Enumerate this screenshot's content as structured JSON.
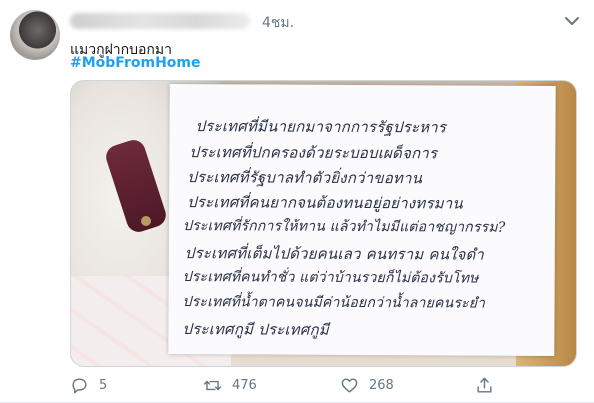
{
  "tweet": {
    "time": "4ชม.",
    "text": "แมวกูฝากบอกมา",
    "hashtag": "#MobFromHome",
    "image_text_lines": [
      "ประเทศที่มีนายกมาจากการรัฐประหาร",
      "ประเทศที่ปกครองด้วยระบอบเผด็จการ",
      "ประเทศที่รัฐบาลทำตัวยิ่งกว่าขอทาน",
      "ประเทศที่คนยากจนต้องทนอยู่อย่างทรมาน",
      "ประเทศที่รักการให้ทาน แล้วทำไมมีแต่อาชญากรรม?",
      "ประเทศที่เต็มไปด้วยคนเลว คนทราม คนใจดำ",
      "ประเทศที่คนทำชั่ว แต่ว่าบ้านรวยก็ไม่ต้องรับโทษ",
      "ประเทศที่น้ำตาคนจนมีค่าน้อยกว่าน้ำลายคนระยำ",
      "ประเทศกูมี ประเทศกูมี"
    ]
  },
  "actions": {
    "reply_count": "5",
    "retweet_count": "476",
    "like_count": "268"
  },
  "icons": {
    "reply": "reply-icon",
    "retweet": "retweet-icon",
    "like": "heart-icon",
    "share": "share-icon",
    "caret": "chevron-down-icon"
  },
  "colors": {
    "accent": "#1da1f2",
    "muted": "#657786"
  }
}
